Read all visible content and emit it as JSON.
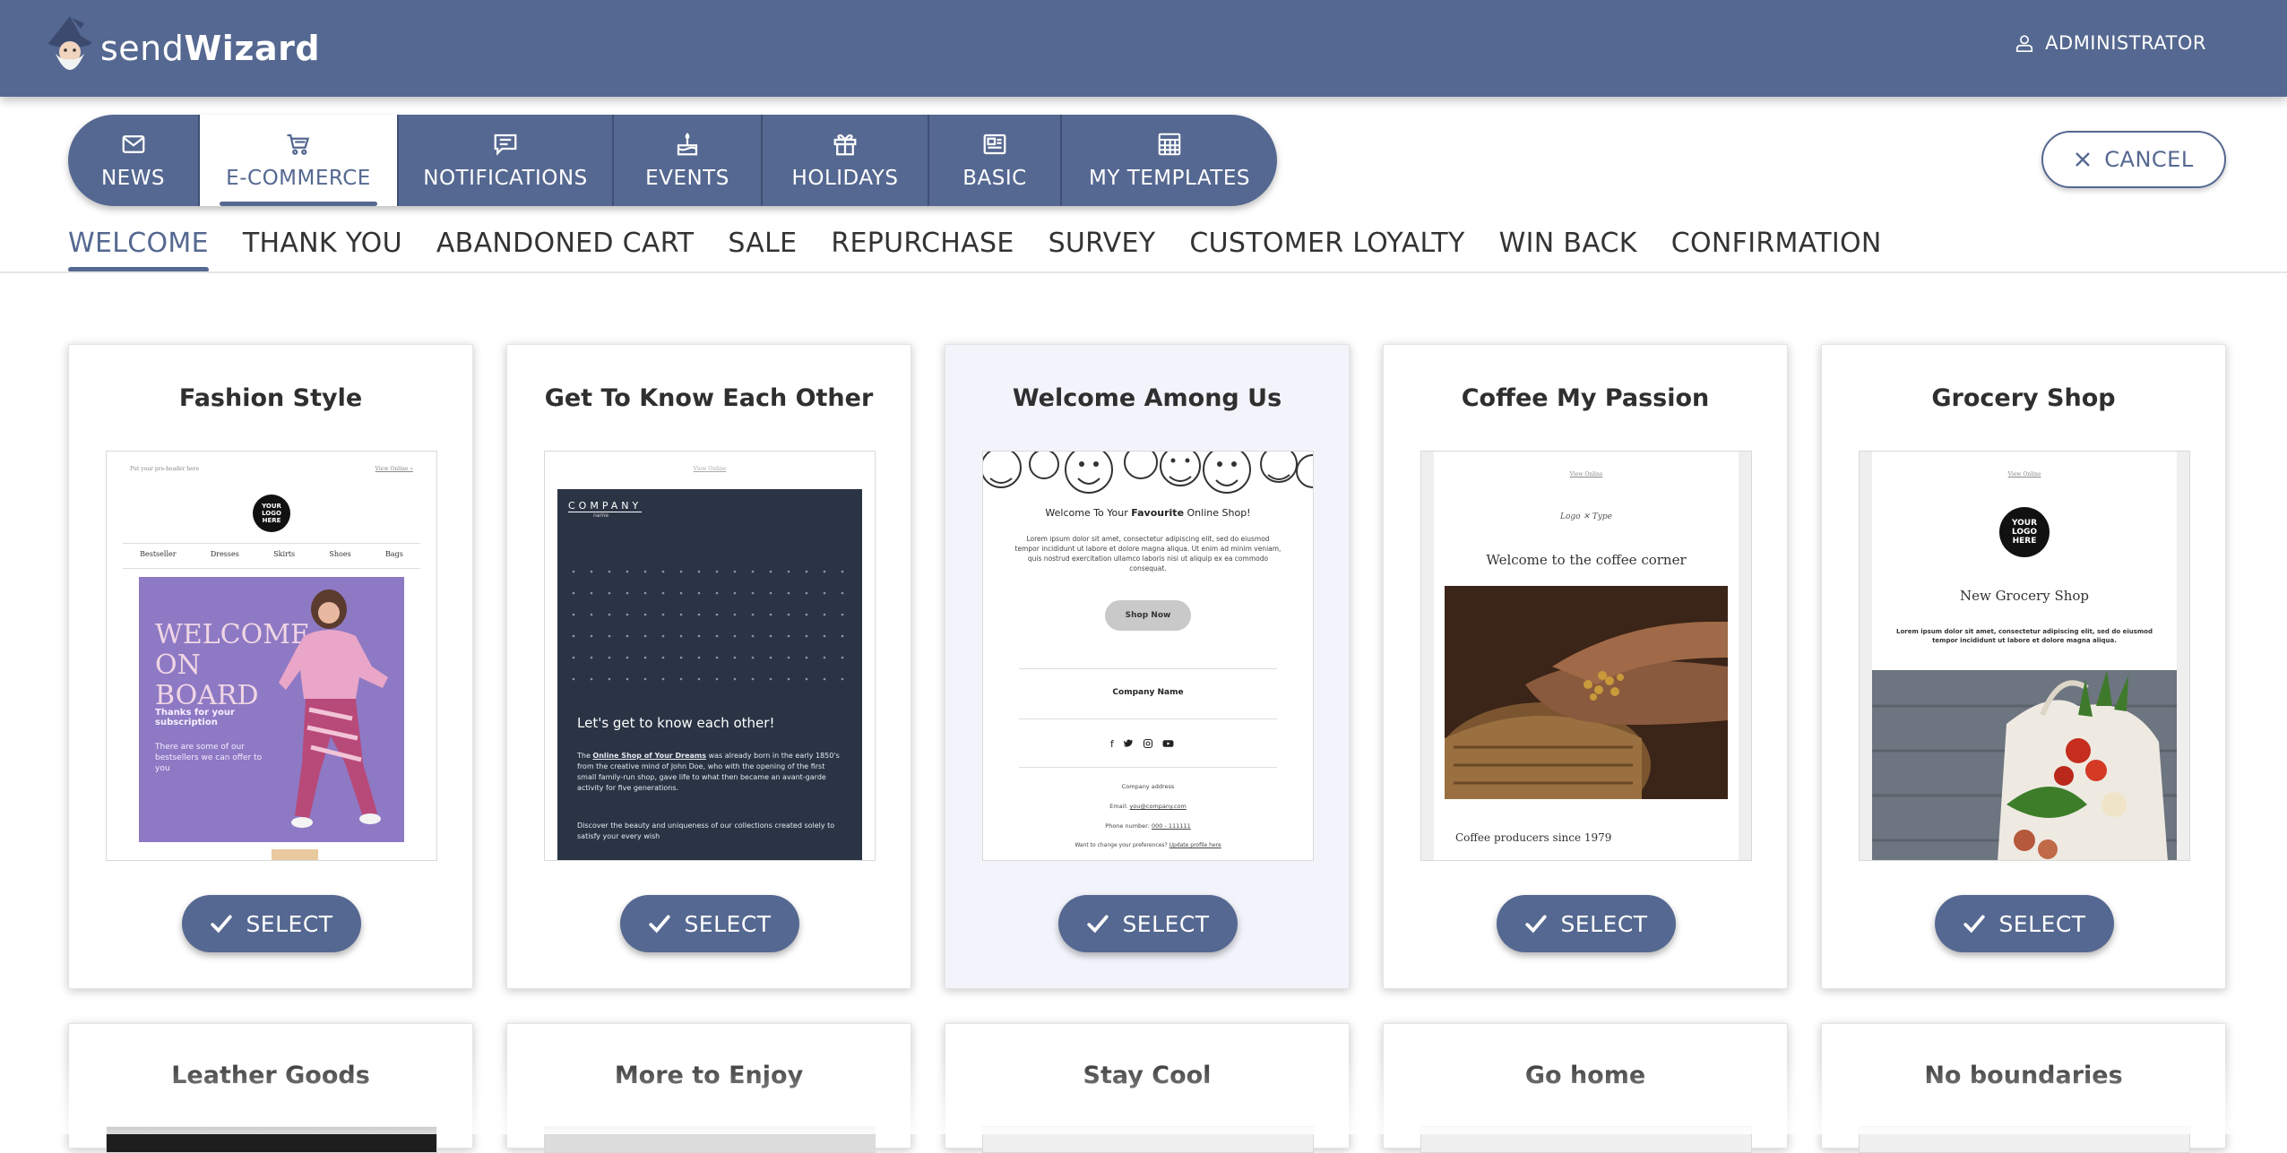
{
  "header": {
    "logo_light": "send",
    "logo_bold": "Wizard",
    "user_label": "ADMINISTRATOR"
  },
  "category_tabs": [
    {
      "label": "NEWS",
      "icon": "envelope-icon",
      "active": false
    },
    {
      "label": "E-COMMERCE",
      "icon": "cart-icon",
      "active": true
    },
    {
      "label": "NOTIFICATIONS",
      "icon": "chat-icon",
      "active": false
    },
    {
      "label": "EVENTS",
      "icon": "cake-icon",
      "active": false
    },
    {
      "label": "HOLIDAYS",
      "icon": "gift-icon",
      "active": false
    },
    {
      "label": "BASIC",
      "icon": "newspaper-icon",
      "active": false
    },
    {
      "label": "MY TEMPLATES",
      "icon": "grid-icon",
      "active": false
    }
  ],
  "cancel_label": "CANCEL",
  "sub_tabs": [
    {
      "label": "WELCOME",
      "active": true
    },
    {
      "label": "THANK YOU",
      "active": false
    },
    {
      "label": "ABANDONED CART",
      "active": false
    },
    {
      "label": "SALE",
      "active": false
    },
    {
      "label": "REPURCHASE",
      "active": false
    },
    {
      "label": "SURVEY",
      "active": false
    },
    {
      "label": "CUSTOMER LOYALTY",
      "active": false
    },
    {
      "label": "WIN BACK",
      "active": false
    },
    {
      "label": "CONFIRMATION",
      "active": false
    }
  ],
  "select_label": "SELECT",
  "templates": [
    {
      "title": "Fashion Style",
      "preheader": "Put your pre-header here",
      "view_online": "View Online »",
      "logo": "YOUR LOGO HERE",
      "menu": [
        "Bestseller",
        "Dresses",
        "Skirts",
        "Shoes",
        "Bags"
      ],
      "hero_title": "WELCOME ON BOARD",
      "hero_sub": "Thanks for your subscription",
      "hero_text": "There are some of our bestsellers we can offer to you"
    },
    {
      "title": "Get To Know Each Other",
      "view_online": "View Online",
      "company": "COMPANY",
      "company_sub": "name",
      "heading": "Let's get to know each other!",
      "para1_pre": "The ",
      "para1_link": "Online Shop of Your Dreams",
      "para1_post": " was already born in the early 1850's from the creative mind of John Doe, who with the opening of the first small family-run shop, gave life to what then became an avant-garde activity for five generations.",
      "para2": "Discover the beauty and uniqueness of our collections created solely to satisfy your every wish"
    },
    {
      "title": "Welcome Among Us",
      "heading_pre": "Welcome To Your ",
      "heading_bold": "Favourite",
      "heading_post": " Online Shop!",
      "body": "Lorem ipsum dolor sit amet, consectetur adipiscing elit, sed do eiusmod tempor incididunt ut labore et dolore magna aliqua. Ut enim ad minim veniam, quis nostrud exercitation ullamco laboris nisi ut aliquip ex ea commodo consequat.",
      "button": "Shop Now",
      "company": "Company Name",
      "address": "Company address",
      "email_label": "Email:",
      "email": "you@company.com",
      "phone_label": "Phone number:",
      "phone": "000 - 111111",
      "prefs_pre": "Want to change your preferences? ",
      "prefs_link": "Update profile here"
    },
    {
      "title": "Coffee My Passion",
      "view_online": "View Online",
      "logo": "Logo ✕ Type",
      "heading": "Welcome to the coffee corner",
      "footer": "Coffee producers since 1979"
    },
    {
      "title": "Grocery Shop",
      "view_online": "View Online",
      "logo": "YOUR LOGO HERE",
      "heading": "New Grocery Shop",
      "body": "Lorem ipsum dolor sit amet, consectetur adipiscing elit, sed do eiusmod tempor incididunt ut labore et dolore magna aliqua."
    }
  ],
  "templates_row2": [
    "Leather Goods",
    "More to Enjoy",
    "Stay Cool",
    "Go home",
    "No boundaries"
  ],
  "colors": {
    "primary": "#556891",
    "card_highlight": "#f3f4fb",
    "dark_preview": "#2a3445",
    "fashion_hero": "#8e79c4"
  }
}
